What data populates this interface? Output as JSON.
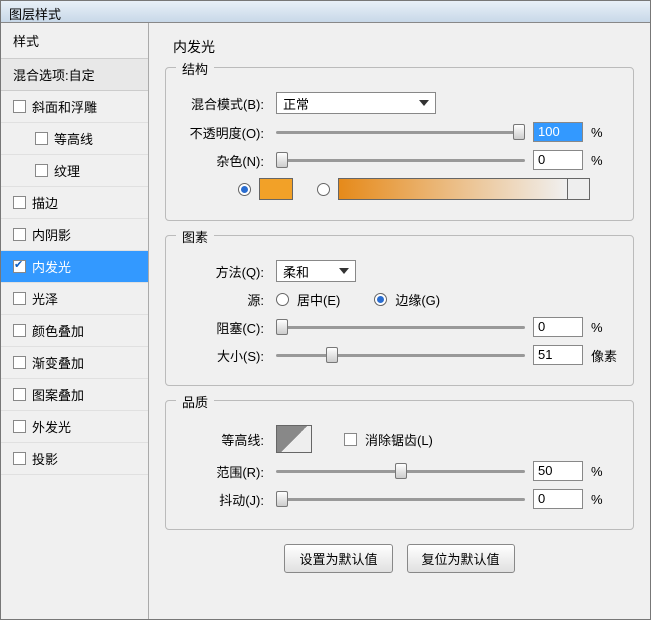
{
  "window_title": "图层样式",
  "sidebar": {
    "header": "样式",
    "subheader": "混合选项:自定",
    "items": [
      {
        "label": "斜面和浮雕",
        "checked": false,
        "indent": false
      },
      {
        "label": "等高线",
        "checked": false,
        "indent": true
      },
      {
        "label": "纹理",
        "checked": false,
        "indent": true
      },
      {
        "label": "描边",
        "checked": false,
        "indent": false
      },
      {
        "label": "内阴影",
        "checked": false,
        "indent": false
      },
      {
        "label": "内发光",
        "checked": true,
        "indent": false,
        "selected": true
      },
      {
        "label": "光泽",
        "checked": false,
        "indent": false
      },
      {
        "label": "颜色叠加",
        "checked": false,
        "indent": false
      },
      {
        "label": "渐变叠加",
        "checked": false,
        "indent": false
      },
      {
        "label": "图案叠加",
        "checked": false,
        "indent": false
      },
      {
        "label": "外发光",
        "checked": false,
        "indent": false
      },
      {
        "label": "投影",
        "checked": false,
        "indent": false
      }
    ]
  },
  "main": {
    "title": "内发光",
    "struct": {
      "title": "结构",
      "blend_label": "混合模式(B):",
      "blend_value": "正常",
      "opacity_label": "不透明度(O):",
      "opacity_value": "100",
      "opacity_unit": "%",
      "noise_label": "杂色(N):",
      "noise_value": "0",
      "noise_unit": "%",
      "color_swatch": "#f2a128"
    },
    "elem": {
      "title": "图素",
      "method_label": "方法(Q):",
      "method_value": "柔和",
      "source_label": "源:",
      "source_center": "居中(E)",
      "source_edge": "边缘(G)",
      "source_selected": "edge",
      "choke_label": "阻塞(C):",
      "choke_value": "0",
      "choke_unit": "%",
      "size_label": "大小(S):",
      "size_value": "51",
      "size_unit": "像素"
    },
    "qual": {
      "title": "品质",
      "contour_label": "等高线:",
      "aa_label": "消除锯齿(L)",
      "range_label": "范围(R):",
      "range_value": "50",
      "range_unit": "%",
      "jitter_label": "抖动(J):",
      "jitter_value": "0",
      "jitter_unit": "%"
    },
    "buttons": {
      "default": "设置为默认值",
      "reset": "复位为默认值"
    }
  }
}
